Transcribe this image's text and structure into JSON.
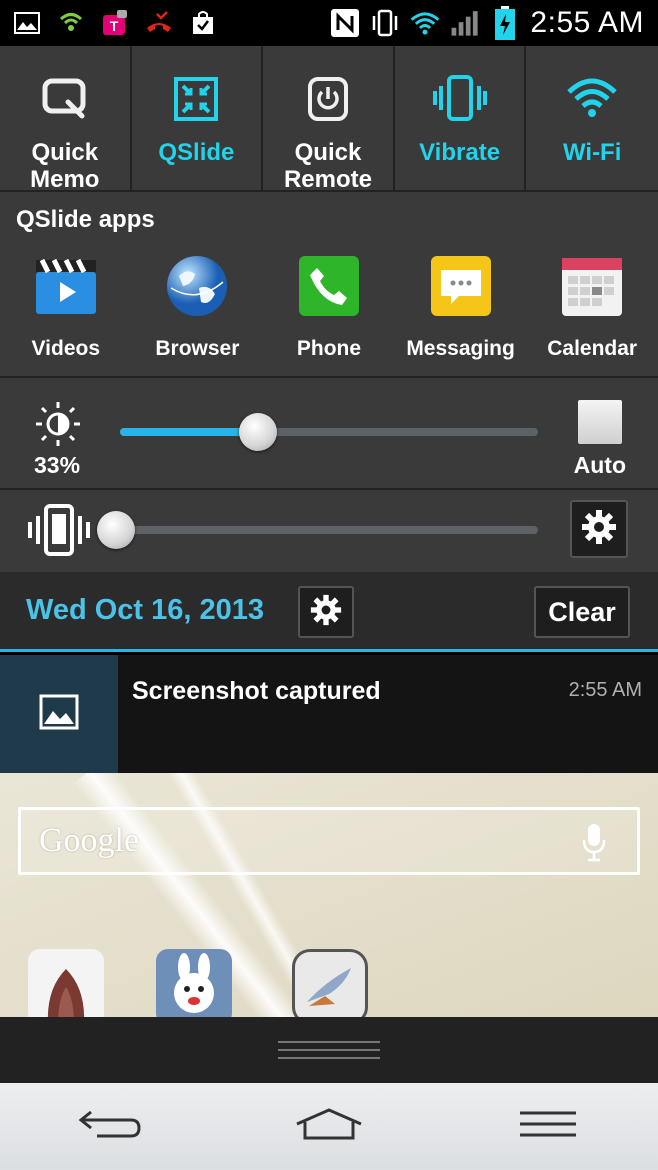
{
  "status_bar": {
    "time": "2:55 AM",
    "left_icons": [
      "gallery-icon",
      "signal-shield-icon",
      "tmobile-icon",
      "missed-call-icon",
      "bag-check-icon"
    ],
    "right_icons": [
      "nfc-icon",
      "vibrate-icon",
      "wifi-icon",
      "cell-signal-icon",
      "battery-charging-icon"
    ]
  },
  "quick_settings": {
    "tiles": [
      {
        "label": "Quick\nMemo",
        "active": false,
        "icon": "quick-memo-icon"
      },
      {
        "label": "QSlide",
        "active": true,
        "icon": "qslide-icon"
      },
      {
        "label": "Quick\nRemote",
        "active": false,
        "icon": "quick-remote-icon"
      },
      {
        "label": "Vibrate",
        "active": true,
        "icon": "vibrate-icon"
      },
      {
        "label": "Wi-Fi",
        "active": true,
        "icon": "wifi-icon"
      }
    ]
  },
  "qslide_apps": {
    "title": "QSlide apps",
    "apps": [
      {
        "label": "Videos",
        "icon": "videos-icon"
      },
      {
        "label": "Browser",
        "icon": "browser-icon"
      },
      {
        "label": "Phone",
        "icon": "phone-icon"
      },
      {
        "label": "Messaging",
        "icon": "messaging-icon"
      },
      {
        "label": "Calendar",
        "icon": "calendar-icon"
      }
    ]
  },
  "brightness": {
    "percent_label": "33%",
    "level": 0.33,
    "auto_label": "Auto",
    "auto_checked": false
  },
  "volume": {
    "level": 0.0,
    "mode_icon": "vibrate-icon"
  },
  "date_bar": {
    "date": "Wed Oct 16, 2013",
    "clear_label": "Clear"
  },
  "notification": {
    "title": "Screenshot captured",
    "time": "2:55 AM",
    "icon": "image-icon"
  },
  "home": {
    "search_label": "Google"
  },
  "colors": {
    "accent": "#22d3ec",
    "date_color": "#4bc3e8",
    "panel": "#3a3a3a"
  }
}
